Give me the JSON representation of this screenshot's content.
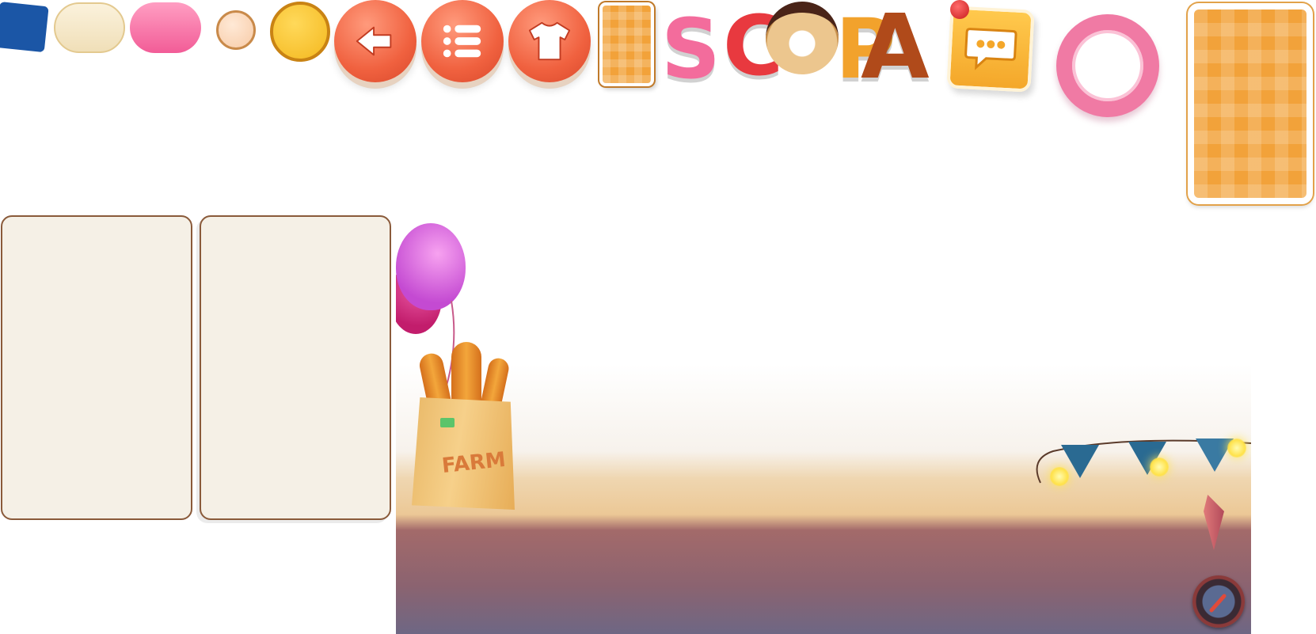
{
  "screen": {
    "logo": {
      "letters": [
        "S",
        "C",
        "O",
        "P",
        "A"
      ]
    },
    "scene": {
      "bag_label": "FARM"
    }
  },
  "colors": {
    "blue_card": "#1b56a6",
    "action_button": "#f0613f",
    "card_back": "#f2a23a",
    "ring": "#f07aa4",
    "card_face": "#f5f0e6",
    "chat_bubble": "#f4a72a"
  },
  "icons": [
    "back-arrow-icon",
    "list-menu-icon",
    "tshirt-icon",
    "chat-bubble-icon"
  ]
}
